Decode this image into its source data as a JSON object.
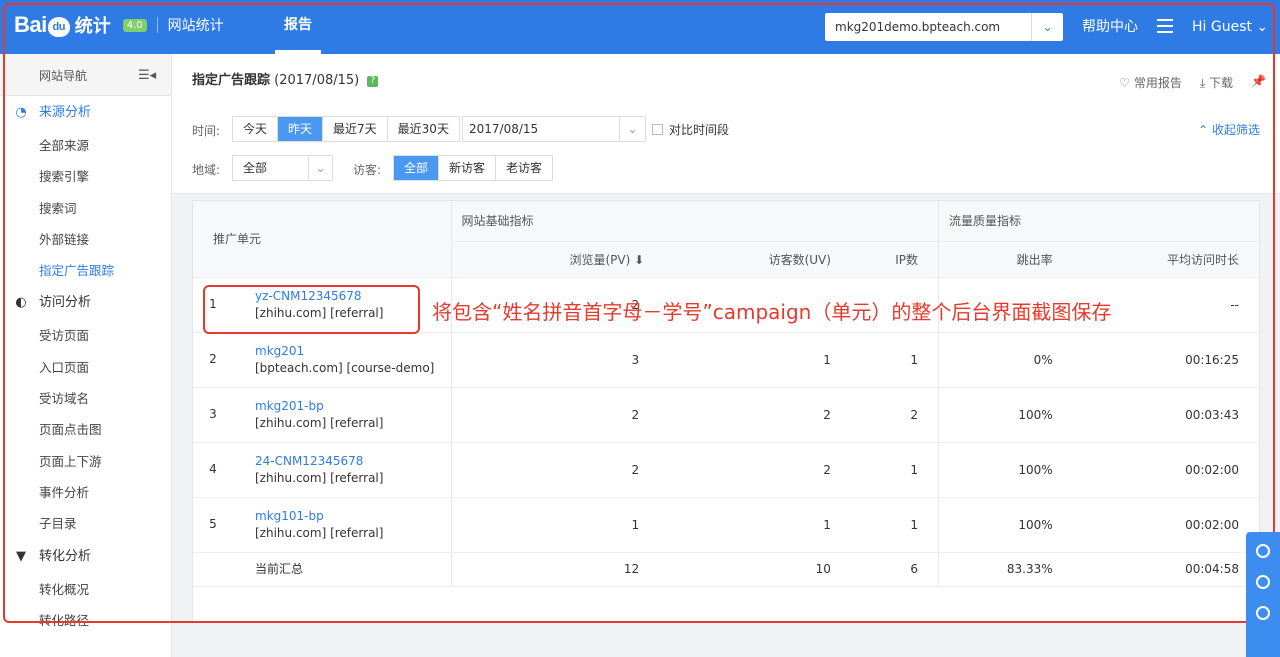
{
  "topbar": {
    "logo_bai": "Bai",
    "logo_du": "du",
    "logo_cn": "统计",
    "logo_badge": "4.0",
    "logo_sub": "网站统计",
    "nav_report": "报告",
    "site": "mkg201demo.bpteach.com",
    "help": "帮助中心",
    "greeting": "Hi  Guest ⌄",
    "accent": "#2e7be6"
  },
  "sidebar": {
    "header": "网站导航",
    "sections": [
      {
        "title": "来源分析",
        "icon": "pie-chart-icon",
        "items": [
          "全部来源",
          "搜索引擎",
          "搜索词",
          "外部链接",
          "指定广告跟踪"
        ]
      },
      {
        "title": "访问分析",
        "icon": "visit-icon",
        "items": [
          "受访页面",
          "入口页面",
          "受访域名",
          "页面点击图",
          "页面上下游",
          "事件分析",
          "子目录"
        ]
      },
      {
        "title": "转化分析",
        "icon": "filter-icon",
        "items": [
          "转化概况",
          "转化路径"
        ]
      }
    ],
    "active_item": "指定广告跟踪"
  },
  "page": {
    "title": "指定广告跟踪",
    "date_suffix": "(2017/08/15)",
    "help_badge": "?",
    "tool_fav": "♡ 常用报告",
    "tool_download": "⤓ 下载",
    "tool_pin": "📌"
  },
  "filters": {
    "time_label": "时间:",
    "time_options": [
      "今天",
      "昨天",
      "最近7天",
      "最近30天"
    ],
    "time_selected": "昨天",
    "date_value": "2017/08/15",
    "compare_label": "对比时间段",
    "collapse_label": "⌃ 收起筛选",
    "region_label": "地域:",
    "region_value": "全部",
    "visitor_label": "访客:",
    "visitor_options": [
      "全部",
      "新访客",
      "老访客"
    ],
    "visitor_selected": "全部"
  },
  "table": {
    "head_unit": "推广单元",
    "group_basic": "网站基础指标",
    "group_quality": "流量质量指标",
    "col_pv": "浏览量(PV) ⬇",
    "col_uv": "访客数(UV)",
    "col_ip": "IP数",
    "col_bounce": "跳出率",
    "col_duration": "平均访问时长",
    "rows": [
      {
        "idx": "1",
        "name": "yz-CNM12345678",
        "source": "[zhihu.com]  [referral]",
        "pv": "2",
        "uv": "",
        "ip": "",
        "bounce": "",
        "duration": "--"
      },
      {
        "idx": "2",
        "name": "mkg201",
        "source": "[bpteach.com]  [course-demo]",
        "pv": "3",
        "uv": "1",
        "ip": "1",
        "bounce": "0%",
        "duration": "00:16:25"
      },
      {
        "idx": "3",
        "name": "mkg201-bp",
        "source": "[zhihu.com]  [referral]",
        "pv": "2",
        "uv": "2",
        "ip": "2",
        "bounce": "100%",
        "duration": "00:03:43"
      },
      {
        "idx": "4",
        "name": "24-CNM12345678",
        "source": "[zhihu.com]  [referral]",
        "pv": "2",
        "uv": "2",
        "ip": "1",
        "bounce": "100%",
        "duration": "00:02:00"
      },
      {
        "idx": "5",
        "name": "mkg101-bp",
        "source": "[zhihu.com]  [referral]",
        "pv": "1",
        "uv": "1",
        "ip": "1",
        "bounce": "100%",
        "duration": "00:02:00"
      }
    ],
    "total": {
      "label": "当前汇总",
      "pv": "12",
      "uv": "10",
      "ip": "6",
      "bounce": "83.33%",
      "duration": "00:04:58"
    }
  },
  "annotation": {
    "text": "将包含“姓名拼音首字母－学号”campaign（单元）的整个后台界面截图保存",
    "color": "#e63a2e"
  }
}
